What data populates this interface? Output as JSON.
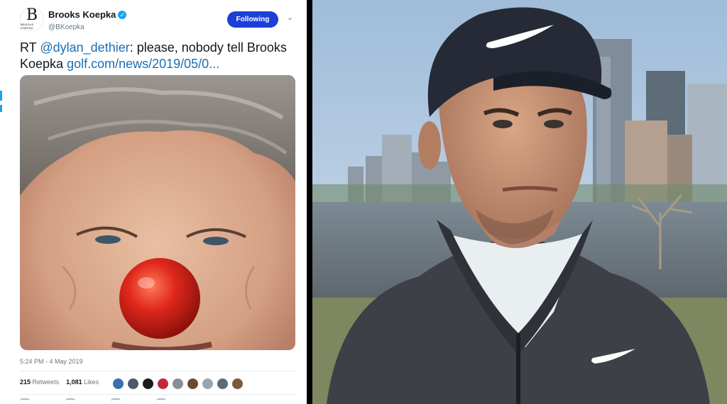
{
  "tweet": {
    "avatar_text": "B",
    "avatar_subtext": "BROOKS KOEPKA",
    "display_name": "Brooks Koepka",
    "verified_icon": "✓",
    "handle": "@BKoepka",
    "follow_label": "Following",
    "caret_icon": "⌄",
    "text_prefix": "RT ",
    "mention": "@dylan_dethier",
    "text_body": ": please, nobody tell Brooks Koepka ",
    "link": "golf.com/news/2019/05/0...",
    "timestamp": "5:24 PM - 4 May 2019",
    "retweets_count": "215",
    "retweets_label": "Retweets",
    "likes_count": "1,081",
    "likes_label": "Likes"
  },
  "icons": {
    "verified": "verified-badge-icon",
    "caret": "chevron-down-icon",
    "actions": [
      "reply-icon",
      "retweet-icon",
      "like-icon",
      "message-icon"
    ]
  },
  "colors": {
    "follow_button": "#1d3fd6",
    "link": "#1b6fb5",
    "clown_nose": "#e0281c",
    "cap": "#252a36",
    "sky": "#b7cde3",
    "water": "#6f7b84"
  },
  "liker_avatar_colors": [
    "#3a6fb0",
    "#4a5a6a",
    "#1b1b1b",
    "#c0283a",
    "#8a8f96",
    "#6b4a2e",
    "#9aa4ad",
    "#5a6b7a",
    "#7a5a3a"
  ]
}
